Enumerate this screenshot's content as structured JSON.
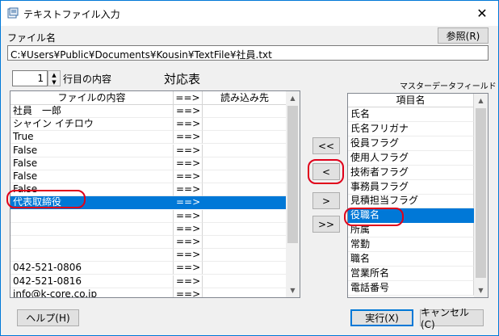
{
  "window": {
    "title": "テキストファイル入力",
    "close_glyph": "✕"
  },
  "file": {
    "label": "ファイル名",
    "path": "C:¥Users¥Public¥Documents¥Kousin¥TextFile¥社員.txt",
    "browse_label": "参照(R)"
  },
  "row_spinner": {
    "value": "1",
    "suffix": "行目の内容"
  },
  "heading": "対応表",
  "master_label": "マスターデータフィールド",
  "mapping_table": {
    "columns": [
      "ファイルの内容",
      "==>",
      "読み込み先"
    ],
    "rows": [
      [
        "社員　一郎",
        "==>",
        ""
      ],
      [
        "シャイン イチロウ",
        "==>",
        ""
      ],
      [
        "True",
        "==>",
        ""
      ],
      [
        "False",
        "==>",
        ""
      ],
      [
        "False",
        "==>",
        ""
      ],
      [
        "False",
        "==>",
        ""
      ],
      [
        "False",
        "==>",
        ""
      ],
      [
        "代表取締役",
        "==>",
        ""
      ],
      [
        "",
        "==>",
        ""
      ],
      [
        "",
        "==>",
        ""
      ],
      [
        "",
        "==>",
        ""
      ],
      [
        "",
        "==>",
        ""
      ],
      [
        "042-521-0806",
        "==>",
        ""
      ],
      [
        "042-521-0816",
        "==>",
        ""
      ],
      [
        "info@k-core.co.jp",
        "==>",
        ""
      ]
    ],
    "selected_index": 7
  },
  "field_list": {
    "header": "項目名",
    "items": [
      "氏名",
      "氏名フリガナ",
      "役員フラグ",
      "使用人フラグ",
      "技術者フラグ",
      "事務員フラグ",
      "見積担当フラグ",
      "役職名",
      "所属",
      "常勤",
      "職名",
      "営業所名",
      "電話番号"
    ],
    "selected_index": 7
  },
  "transfer": {
    "all_left": "<<",
    "left": "<",
    "right": ">",
    "all_right": ">>"
  },
  "footer": {
    "help": "ヘルプ(H)",
    "run": "実行(X)",
    "cancel": "キャンセル(C)"
  },
  "colors": {
    "selection": "#0078d7",
    "highlight_ring": "#e0001a",
    "accent": "#0078d7"
  }
}
